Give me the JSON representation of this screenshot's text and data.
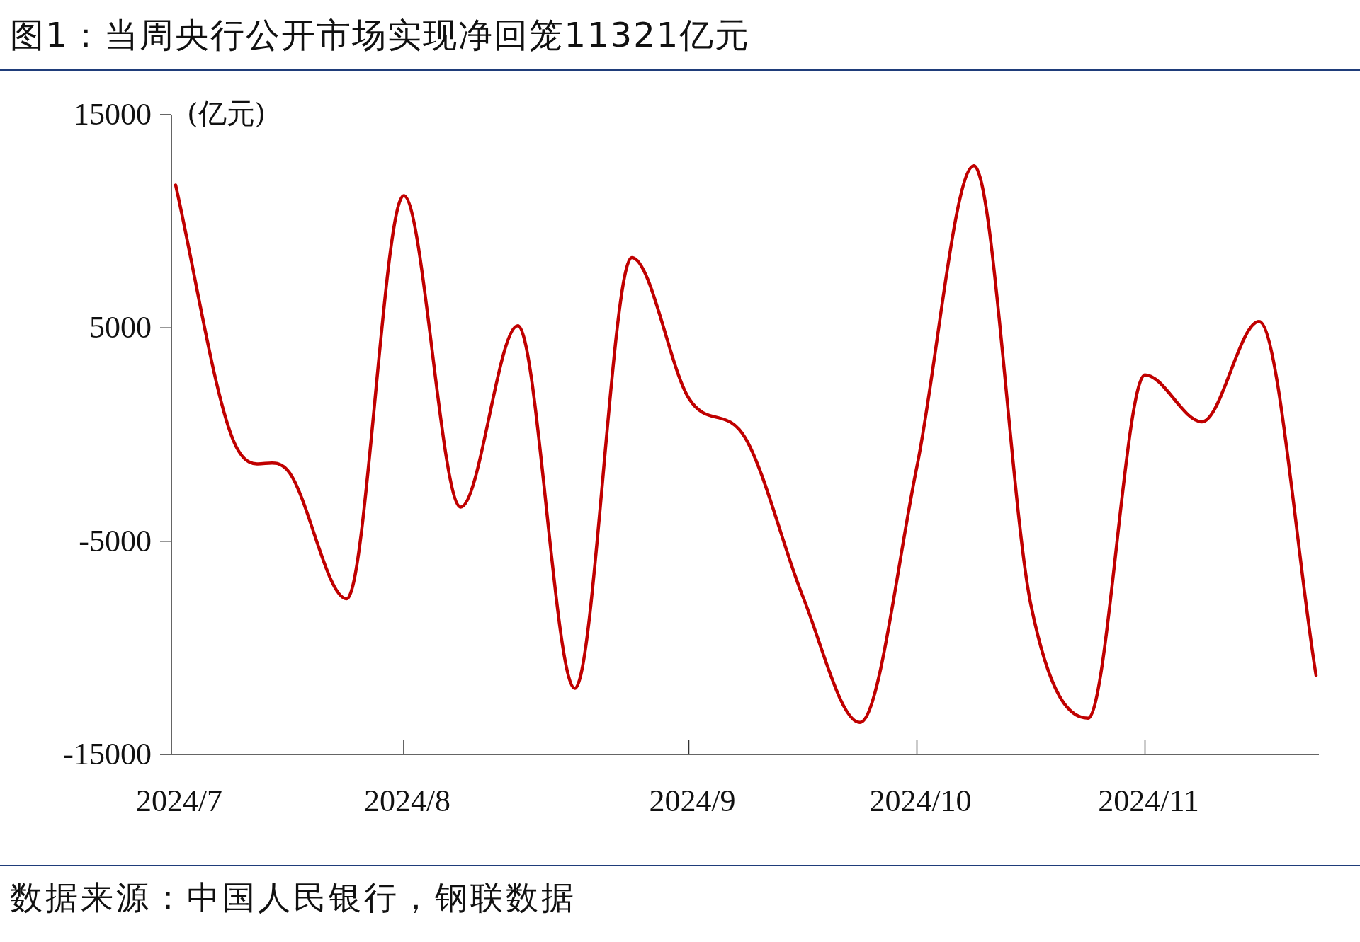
{
  "figure": {
    "title": "图1：当周央行公开市场实现净回笼11321亿元"
  },
  "chart": {
    "chart_data": {
      "type": "line",
      "ylabel": "(亿元)",
      "categories": [
        "2024/7",
        null,
        null,
        null,
        "2024/8",
        null,
        null,
        null,
        null,
        "2024/9",
        null,
        null,
        null,
        "2024/10",
        null,
        null,
        null,
        "2024/11",
        null,
        null,
        null
      ],
      "series": [
        {
          "color": "#c00000",
          "values": [
            11700,
            -200,
            -1800,
            -7700,
            11200,
            -3400,
            5100,
            -11900,
            8300,
            1700,
            -200,
            -7600,
            -13500,
            -1500,
            12600,
            -8000,
            -13300,
            2800,
            600,
            5300,
            -11300
          ]
        }
      ],
      "ylim": [
        -15000,
        15000
      ],
      "yticks": [
        -15000,
        -5000,
        5000,
        15000
      ]
    }
  },
  "source": {
    "text": "数据来源：中国人民银行，钢联数据"
  }
}
